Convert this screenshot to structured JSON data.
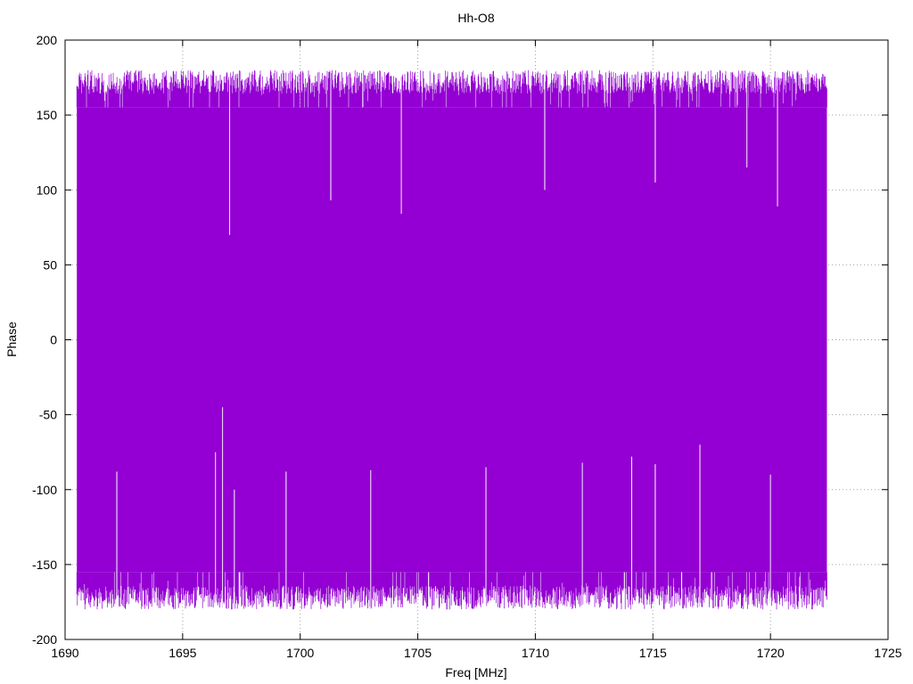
{
  "chart_data": {
    "type": "line",
    "title": "Hh-O8",
    "xlabel": "Freq [MHz]",
    "ylabel": "Phase",
    "xlim": [
      1690,
      1725
    ],
    "ylim": [
      -200,
      200
    ],
    "x_ticks": [
      1690,
      1695,
      1700,
      1705,
      1710,
      1715,
      1720,
      1725
    ],
    "y_ticks": [
      -200,
      -150,
      -100,
      -50,
      0,
      50,
      100,
      150,
      200
    ],
    "grid": true,
    "legend": "none",
    "series": [
      {
        "color": "#9400d3",
        "x_range": [
          1690.5,
          1722.4
        ],
        "oscillating_between": [
          -180,
          180
        ],
        "typical_upper_peak": 170,
        "typical_lower_peak": -170,
        "outlier_upper_dips": [
          {
            "x": 1697.0,
            "y": 70
          },
          {
            "x": 1701.3,
            "y": 93
          },
          {
            "x": 1704.3,
            "y": 84
          },
          {
            "x": 1710.4,
            "y": 100
          },
          {
            "x": 1715.1,
            "y": 105
          },
          {
            "x": 1719.0,
            "y": 115
          },
          {
            "x": 1720.3,
            "y": 89
          }
        ],
        "outlier_lower_peaks": [
          {
            "x": 1696.4,
            "y": -75
          },
          {
            "x": 1696.7,
            "y": -45
          },
          {
            "x": 1692.2,
            "y": -88
          },
          {
            "x": 1697.2,
            "y": -100
          },
          {
            "x": 1699.4,
            "y": -88
          },
          {
            "x": 1703.0,
            "y": -87
          },
          {
            "x": 1707.9,
            "y": -85
          },
          {
            "x": 1712.0,
            "y": -82
          },
          {
            "x": 1714.1,
            "y": -78
          },
          {
            "x": 1715.1,
            "y": -83
          },
          {
            "x": 1717.0,
            "y": -70
          },
          {
            "x": 1720.0,
            "y": -90
          }
        ]
      }
    ]
  }
}
